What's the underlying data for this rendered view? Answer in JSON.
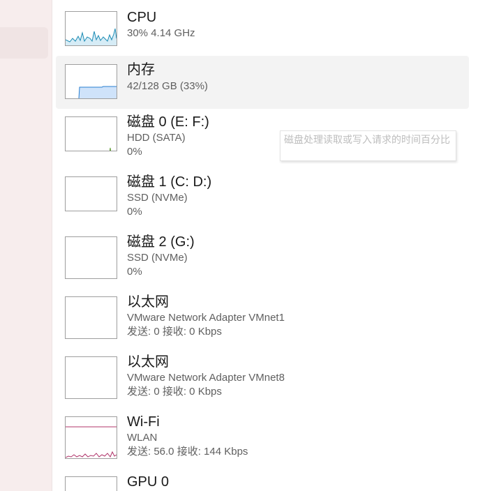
{
  "colors": {
    "cpu": "#1b8bb4",
    "memory": "#2a7fd0",
    "disk": "#5a9a2a",
    "network": "#b0346a"
  },
  "items": [
    {
      "title": "CPU",
      "line1": "30% 4.14 GHz",
      "line2": ""
    },
    {
      "title": "内存",
      "line1": "42/128 GB (33%)",
      "line2": ""
    },
    {
      "title": "磁盘 0 (E: F:)",
      "line1": "HDD (SATA)",
      "line2": "0%"
    },
    {
      "title": "磁盘 1 (C: D:)",
      "line1": "SSD (NVMe)",
      "line2": "0%"
    },
    {
      "title": "磁盘 2 (G:)",
      "line1": "SSD (NVMe)",
      "line2": "0%"
    },
    {
      "title": "以太网",
      "line1": "VMware Network Adapter VMnet1",
      "line2": "发送: 0 接收: 0 Kbps"
    },
    {
      "title": "以太网",
      "line1": "VMware Network Adapter VMnet8",
      "line2": "发送: 0 接收: 0 Kbps"
    },
    {
      "title": "Wi-Fi",
      "line1": "WLAN",
      "line2": "发送: 56.0 接收: 144 Kbps"
    },
    {
      "title": "GPU 0",
      "line1": "",
      "line2": ""
    }
  ],
  "tooltip": {
    "text": "磁盘处理读取或写入请求的时间百分比"
  }
}
